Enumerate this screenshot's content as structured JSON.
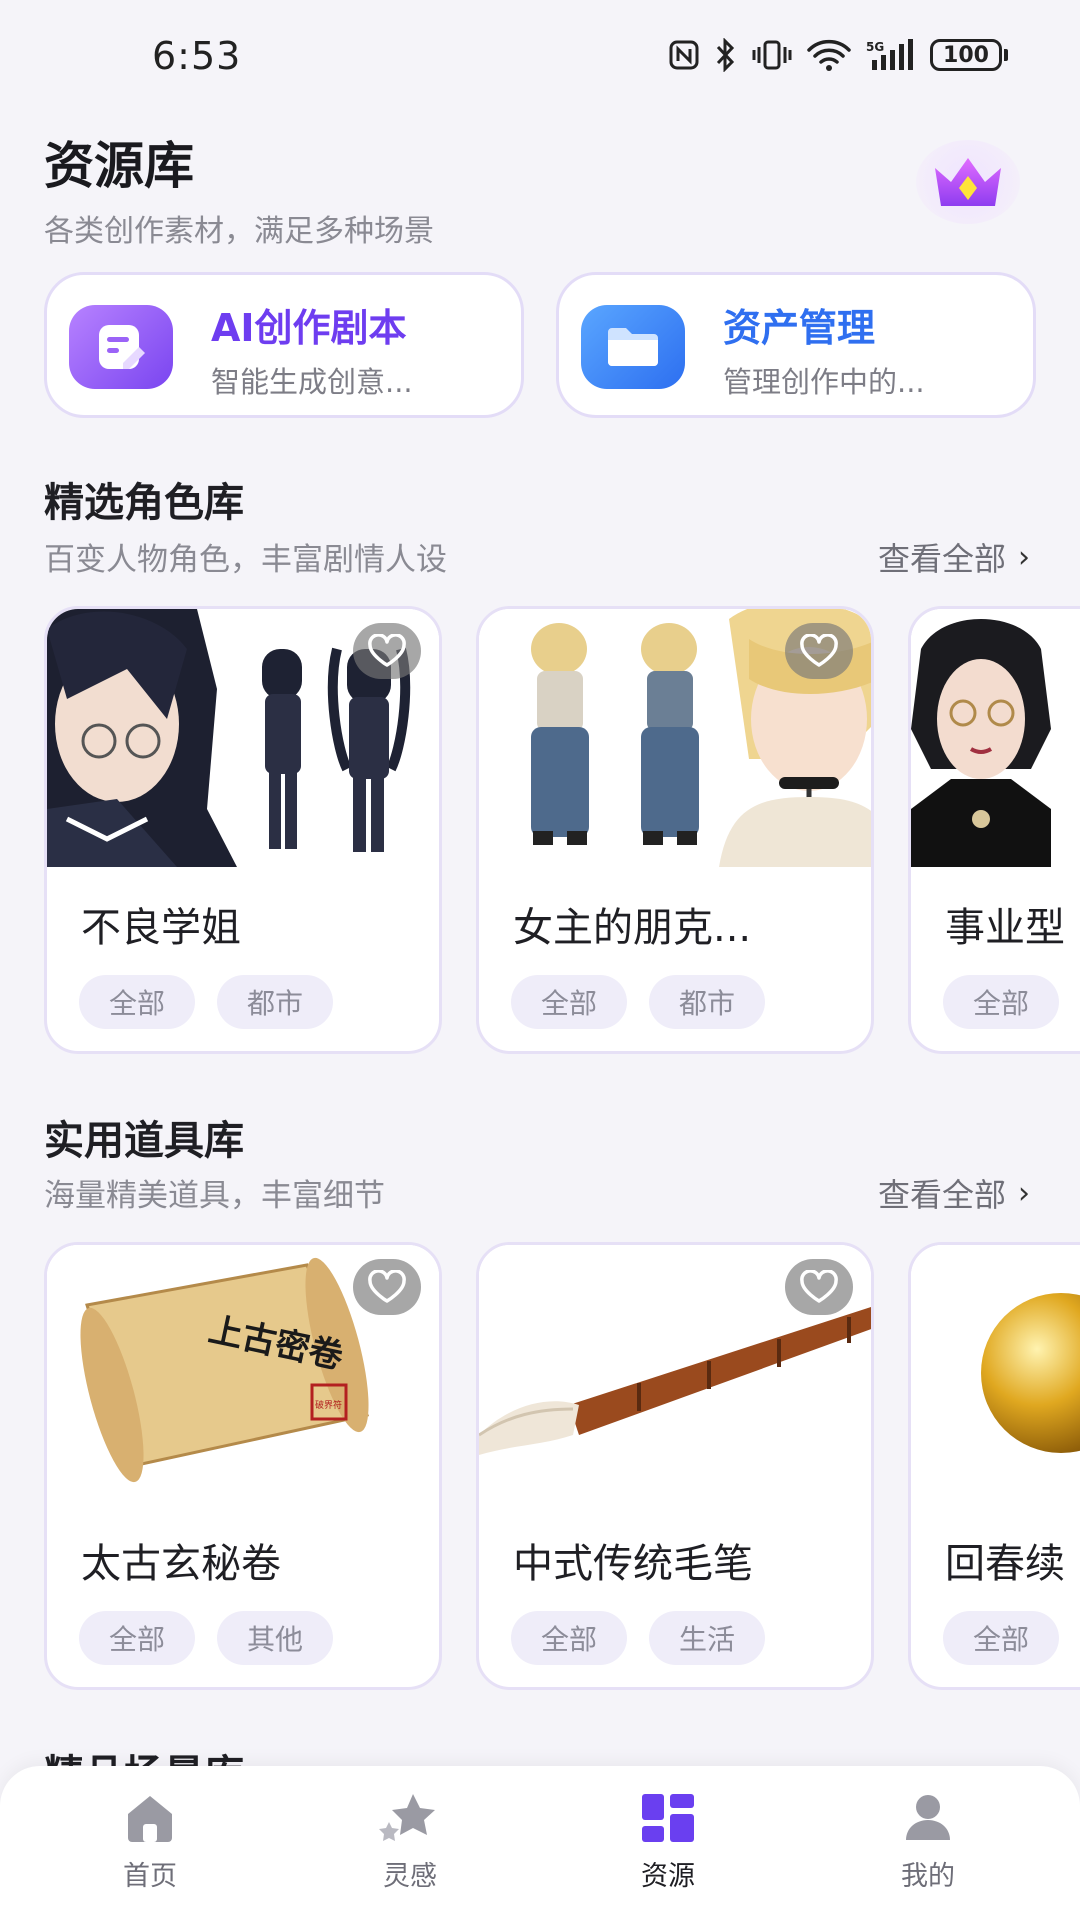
{
  "status_bar": {
    "time": "6:53",
    "battery": "100"
  },
  "header": {
    "title": "资源库",
    "subtitle": "各类创作素材，满足多种场景",
    "vip_icon": "crown-icon"
  },
  "features": [
    {
      "title": "AI创作剧本",
      "desc": "智能生成创意...",
      "icon": "script-edit-icon",
      "color": "#6e3df0"
    },
    {
      "title": "资产管理",
      "desc": "管理创作中的...",
      "icon": "folder-icon",
      "color": "#2f6ff0"
    }
  ],
  "sections": {
    "characters": {
      "title": "精选角色库",
      "subtitle": "百变人物角色，丰富剧情人设",
      "see_all": "查看全部",
      "items": [
        {
          "name": "不良学姐",
          "tags": [
            "全部",
            "都市"
          ]
        },
        {
          "name": "女主的朋克...",
          "tags": [
            "全部",
            "都市"
          ]
        },
        {
          "name": "事业型",
          "tags": [
            "全部"
          ]
        }
      ]
    },
    "props": {
      "title": "实用道具库",
      "subtitle": "海量精美道具，丰富细节",
      "see_all": "查看全部",
      "items": [
        {
          "name": "太古玄秘卷",
          "tags": [
            "全部",
            "其他"
          ],
          "image_text": "上古密卷",
          "seal_text": "破界符"
        },
        {
          "name": "中式传统毛笔",
          "tags": [
            "全部",
            "生活"
          ]
        },
        {
          "name": "回春续",
          "tags": [
            "全部"
          ]
        }
      ]
    },
    "scenes": {
      "title": "精品场景库"
    }
  },
  "bottom_nav": [
    {
      "label": "首页",
      "icon": "home-icon",
      "active": false
    },
    {
      "label": "灵感",
      "icon": "stars-icon",
      "active": false
    },
    {
      "label": "资源",
      "icon": "grid-icon",
      "active": true
    },
    {
      "label": "我的",
      "icon": "profile-icon",
      "active": false
    }
  ],
  "colors": {
    "accent": "#6e3df0",
    "nav_active": "#6a3ff0",
    "background": "#f5f4f9"
  }
}
